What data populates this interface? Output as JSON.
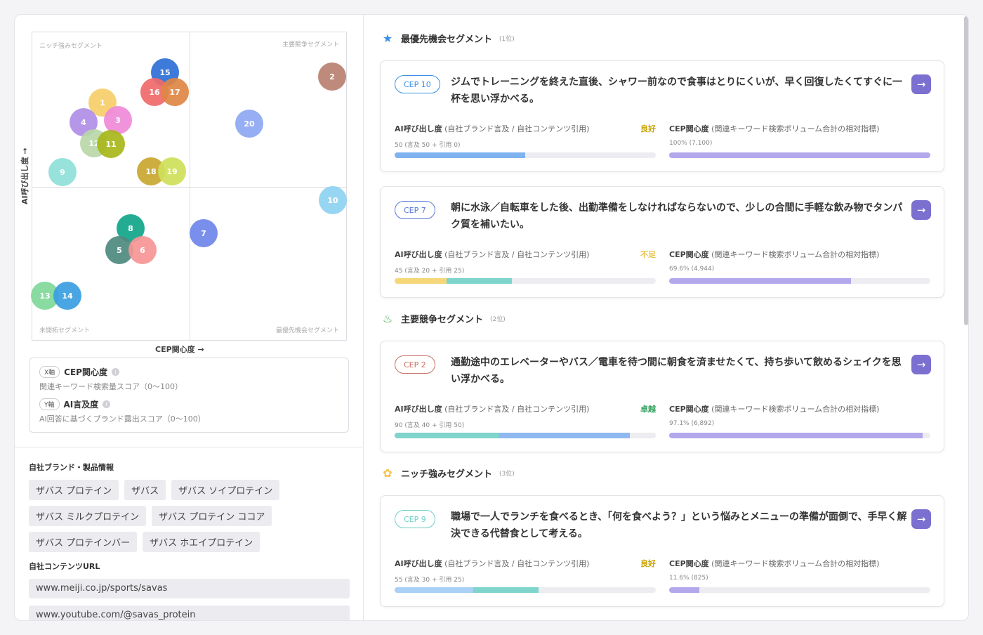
{
  "matrix": {
    "quadrants": {
      "top_left": "ニッチ強みセグメント",
      "top_right": "主要競争セグメント",
      "bottom_left": "未開拓セグメント",
      "bottom_right": "最優先機会セグメント"
    },
    "y_label": "AI呼び出し度 →",
    "x_label": "CEP関心度 →",
    "bubbles": [
      {
        "label": "15",
        "color": "#2d6fd6"
      },
      {
        "label": "16",
        "color": "#f06a6a"
      },
      {
        "label": "17",
        "color": "#e08645"
      },
      {
        "label": "1",
        "color": "#f7cf6a"
      },
      {
        "label": "4",
        "color": "#b08ee8"
      },
      {
        "label": "3",
        "color": "#f08ad8"
      },
      {
        "label": "12",
        "color": "#b9d7a8"
      },
      {
        "label": "11",
        "color": "#a9b81c"
      },
      {
        "label": "9",
        "color": "#8fe0d8"
      },
      {
        "label": "18",
        "color": "#c9a730"
      },
      {
        "label": "19",
        "color": "#cfe05a"
      },
      {
        "label": "20",
        "color": "#8ea8f2"
      },
      {
        "label": "2",
        "color": "#b98070"
      },
      {
        "label": "10",
        "color": "#8fd3f2"
      },
      {
        "label": "8",
        "color": "#12a68a"
      },
      {
        "label": "5",
        "color": "#4f8a80"
      },
      {
        "label": "6",
        "color": "#f79595"
      },
      {
        "label": "7",
        "color": "#6f86ea"
      },
      {
        "label": "13",
        "color": "#7fd89a"
      },
      {
        "label": "14",
        "color": "#3a9fe0"
      }
    ]
  },
  "legend": {
    "x_chip": "X軸",
    "x_title": "CEP関心度",
    "x_desc": "関連キーワード検索量スコア（0〜100）",
    "y_chip": "Y軸",
    "y_title": "AI言及度",
    "y_desc": "AI回答に基づくブランド露出スコア（0〜100）",
    "info_glyph": "i"
  },
  "brand": {
    "label": "自社ブランド・製品情報",
    "chips": [
      "ザバス プロテイン",
      "ザバス",
      "ザバス ソイプロテイン",
      "ザバス ミルクプロテイン",
      "ザバス プロテイン ココア",
      "ザバス プロテインバー",
      "ザバス ホエイプロテイン"
    ],
    "url_label": "自社コンテンツURL",
    "urls": [
      "www.meiji.co.jp/sports/savas",
      "www.youtube.com/@savas_protein"
    ]
  },
  "segments": [
    {
      "title": "最優先機会セグメント",
      "rank": "(1位)",
      "icon": "★",
      "icon_name": "star-icon",
      "icon_color": "#3a8fe8"
    },
    {
      "title": "主要競争セグメント",
      "rank": "(2位)",
      "icon": "♨",
      "icon_name": "flame-icon",
      "icon_color": "#4caf50"
    },
    {
      "title": "ニッチ強みセグメント",
      "rank": "(3位)",
      "icon": "✿",
      "icon_name": "clover-icon",
      "icon_color": "#f2c14e"
    }
  ],
  "card_labels": {
    "ai_title": "AI呼び出し度",
    "ai_sub": "(自社ブランド言及 / 自社コンテンツ引用)",
    "cep_title": "CEP関心度",
    "cep_sub": "(関連キーワード検索ボリューム合計の相対指標)",
    "arrow": "→"
  },
  "cards": [
    {
      "tag": "CEP 10",
      "tag_color": "#3a8fe8",
      "text": "ジムでトレーニングを終えた直後、シャワー前なので食事はとりにくいが、早く回復したくてすぐに一杯を思い浮かべる。",
      "status": "良好",
      "status_color": "#c9a100",
      "ai_detail": "50 (言及 50 + 引用 0)",
      "ai_mention": 50,
      "ai_citation": 0,
      "cep_detail": "100% (7,100)",
      "cep_value": 100,
      "ai_colors": [
        "#7fb3f0",
        "#7fd4cc"
      ]
    },
    {
      "tag": "CEP 7",
      "tag_color": "#5a78d8",
      "text": "朝に水泳／自転車をした後、出勤準備をしなければならないので、少しの合間に手軽な飲み物でタンパク質を補いたい。",
      "status": "不足",
      "status_color": "#e8c24a",
      "ai_detail": "45 (言及 20 + 引用 25)",
      "ai_mention": 20,
      "ai_citation": 25,
      "cep_detail": "69.6% (4,944)",
      "cep_value": 69.6,
      "ai_colors": [
        "#f5d77a",
        "#7fd4cc"
      ]
    },
    {
      "tag": "CEP 2",
      "tag_color": "#c97060",
      "text": "通勤途中のエレベーターやバス／電車を待つ間に朝食を済ませたくて、持ち歩いて飲めるシェイクを思い浮かべる。",
      "status": "卓越",
      "status_color": "#2e9e5a",
      "ai_detail": "90 (言及 40 + 引用 50)",
      "ai_mention": 40,
      "ai_citation": 50,
      "cep_detail": "97.1% (6,892)",
      "cep_value": 97.1,
      "ai_colors": [
        "#7fd4cc",
        "#8fb9f0"
      ]
    },
    {
      "tag": "CEP 9",
      "tag_color": "#6fd0c6",
      "text": "職場で一人でランチを食べるとき、「何を食べよう？」という悩みとメニューの準備が面倒で、手早く解決できる代替食として考える。",
      "status": "良好",
      "status_color": "#c9a100",
      "ai_detail": "55 (言及 30 + 引用 25)",
      "ai_mention": 30,
      "ai_citation": 25,
      "cep_detail": "11.6% (825)",
      "cep_value": 11.6,
      "ai_colors": [
        "#a9d0f5",
        "#7fd4cc"
      ]
    }
  ]
}
